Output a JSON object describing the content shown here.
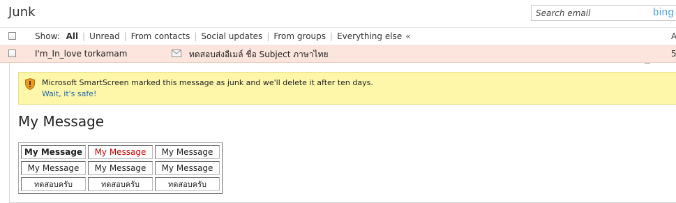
{
  "header": {
    "folder_title": "Junk",
    "search_placeholder": "Search email",
    "search_brand": "bing"
  },
  "filters": {
    "show_label": "Show:",
    "items": [
      {
        "label": "All",
        "active": true
      },
      {
        "label": "Unread",
        "active": false
      },
      {
        "label": "From contacts",
        "active": false
      },
      {
        "label": "Social updates",
        "active": false
      },
      {
        "label": "From groups",
        "active": false
      },
      {
        "label": "Everything else",
        "active": false
      }
    ],
    "collapse_glyph": "«",
    "column_header_fragment": "A"
  },
  "message_row": {
    "sender": "I'm_In_love torkamam",
    "icon": "envelope-icon",
    "subject": "ทดสอบส่งอีเมล์ ชื่อ Subject ภาษาไทย",
    "date_fragment": "5",
    "background_color": "#fbe5dc"
  },
  "warning": {
    "icon": "shield-warning-icon",
    "text": "Microsoft SmartScreen marked this message as junk and we'll delete it after ten days.",
    "link": "Wait, it's safe!",
    "background_color": "#fef7a9"
  },
  "message_body": {
    "heading": "My Message",
    "table_rows": [
      [
        "My Message",
        "My Message",
        "My Message"
      ],
      [
        "My Message",
        "My Message",
        "My Message"
      ],
      [
        "ทดสอบครับ",
        "ทดสอบครับ",
        "ทดสอบครับ"
      ]
    ],
    "accent_red": "#cc0000"
  }
}
